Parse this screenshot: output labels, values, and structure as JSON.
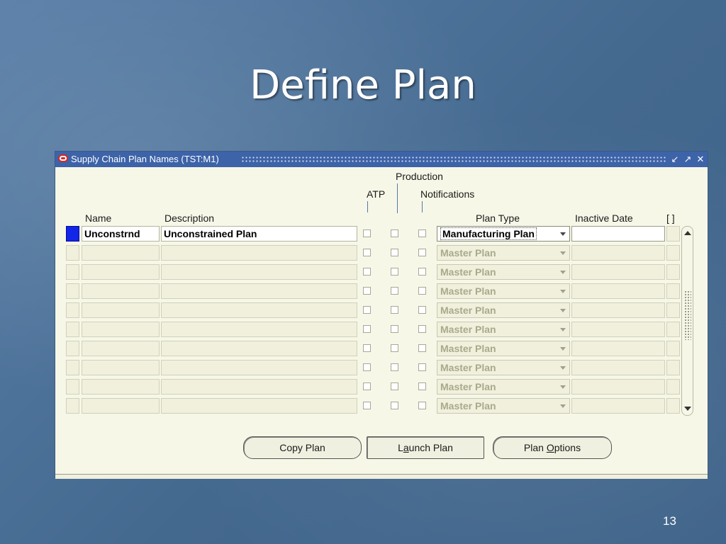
{
  "slide": {
    "title": "Define Plan",
    "page_number": "13"
  },
  "window": {
    "title": "Supply Chain Plan Names (TST:M1)"
  },
  "columns": {
    "production": "Production",
    "atp": "ATP",
    "notifications": "Notifications",
    "name": "Name",
    "description": "Description",
    "plan_type": "Plan Type",
    "inactive_date": "Inactive Date",
    "flex": "[ ]"
  },
  "rows": [
    {
      "name": "Unconstrnd",
      "description": "Unconstrained Plan",
      "plan_type": "Manufacturing Plan",
      "inactive_date": ""
    },
    {
      "name": "",
      "description": "",
      "plan_type": "Master Plan",
      "inactive_date": ""
    },
    {
      "name": "",
      "description": "",
      "plan_type": "Master Plan",
      "inactive_date": ""
    },
    {
      "name": "",
      "description": "",
      "plan_type": "Master Plan",
      "inactive_date": ""
    },
    {
      "name": "",
      "description": "",
      "plan_type": "Master Plan",
      "inactive_date": ""
    },
    {
      "name": "",
      "description": "",
      "plan_type": "Master Plan",
      "inactive_date": ""
    },
    {
      "name": "",
      "description": "",
      "plan_type": "Master Plan",
      "inactive_date": ""
    },
    {
      "name": "",
      "description": "",
      "plan_type": "Master Plan",
      "inactive_date": ""
    },
    {
      "name": "",
      "description": "",
      "plan_type": "Master Plan",
      "inactive_date": ""
    },
    {
      "name": "",
      "description": "",
      "plan_type": "Master Plan",
      "inactive_date": ""
    }
  ],
  "buttons": {
    "copy_plan": "Copy Plan",
    "launch_plan_pre": "L",
    "launch_plan_ul": "a",
    "launch_plan_post": "unch Plan",
    "plan_options_pre": "Plan ",
    "plan_options_ul": "O",
    "plan_options_post": "ptions"
  },
  "colors": {
    "titlebar": "#3d63a8",
    "current_row_indicator": "#1226e8",
    "form_background": "#f7f7e7"
  }
}
